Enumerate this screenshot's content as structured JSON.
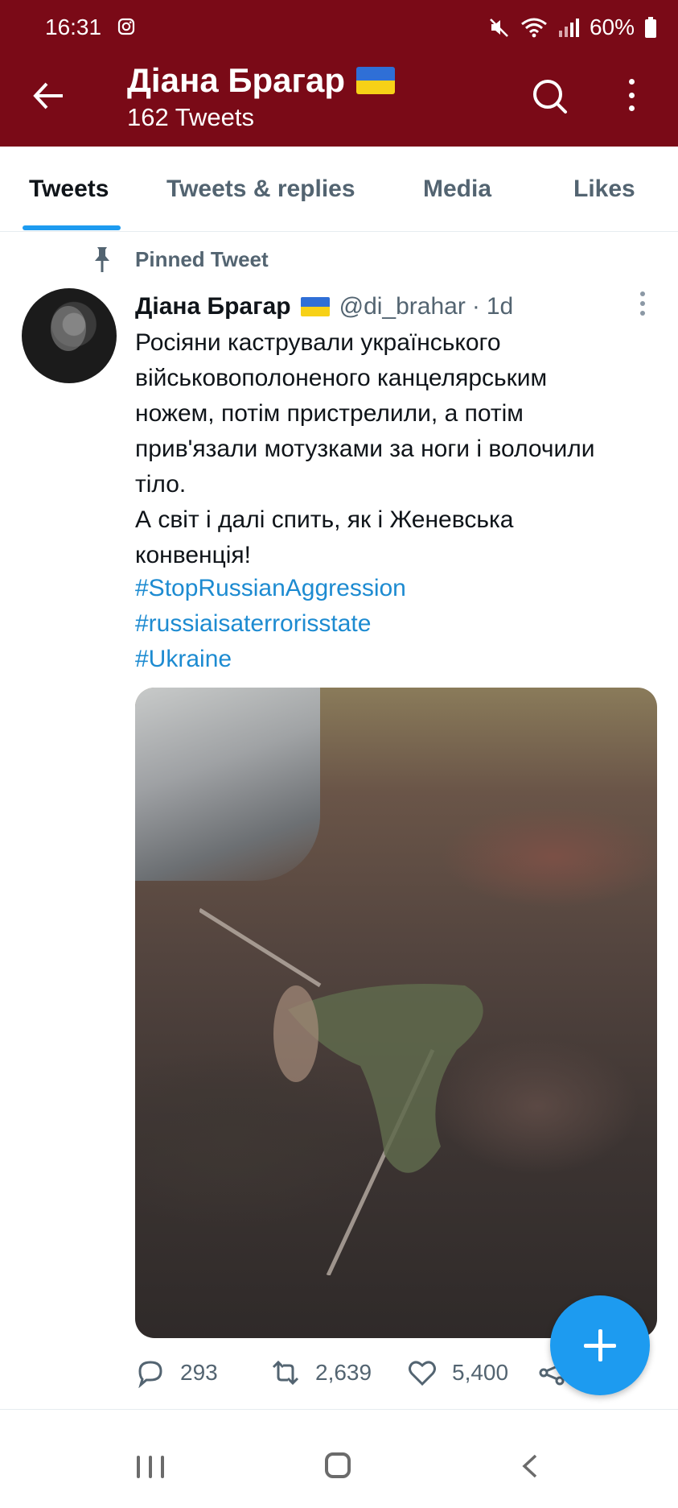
{
  "status_bar": {
    "time": "16:31",
    "battery": "60%"
  },
  "header": {
    "name": "Діана Брагар",
    "tweets_count": "162 Tweets"
  },
  "tabs": [
    {
      "label": "Tweets",
      "active": true
    },
    {
      "label": "Tweets & replies",
      "active": false
    },
    {
      "label": "Media",
      "active": false
    },
    {
      "label": "Likes",
      "active": false
    }
  ],
  "tweet": {
    "pinned_label": "Pinned Tweet",
    "author_name": "Діана Брагар",
    "handle": "@di_brahar",
    "separator": "·",
    "time": "1d",
    "text_lines": [
      "Росіяни кастрували українського",
      "військовополоненого канцелярським",
      "ножем, потім пристрелили, а потім",
      "прив'язали мотузками за ноги і волочили",
      "тіло.",
      "А світ і далі спить, як і Женевська",
      "конвенція!"
    ],
    "hashtags": [
      "#StopRussianAggression",
      "#russiaisaterrorisstate",
      "#Ukraine"
    ],
    "replies": "293",
    "retweets": "2,639",
    "likes": "5,400"
  },
  "colors": {
    "header_bg": "#7a0a17",
    "accent": "#1d9bf0",
    "hashtag": "#1d8bd1",
    "flag_blue": "#2f6fd6",
    "flag_yellow": "#f7d117"
  },
  "icons": [
    "camera-icon",
    "mute-icon",
    "wifi-icon",
    "signal-icon",
    "battery-icon",
    "back-arrow-icon",
    "search-icon",
    "more-icon",
    "pin-icon",
    "reply-icon",
    "retweet-icon",
    "like-icon",
    "share-icon",
    "compose-icon"
  ]
}
